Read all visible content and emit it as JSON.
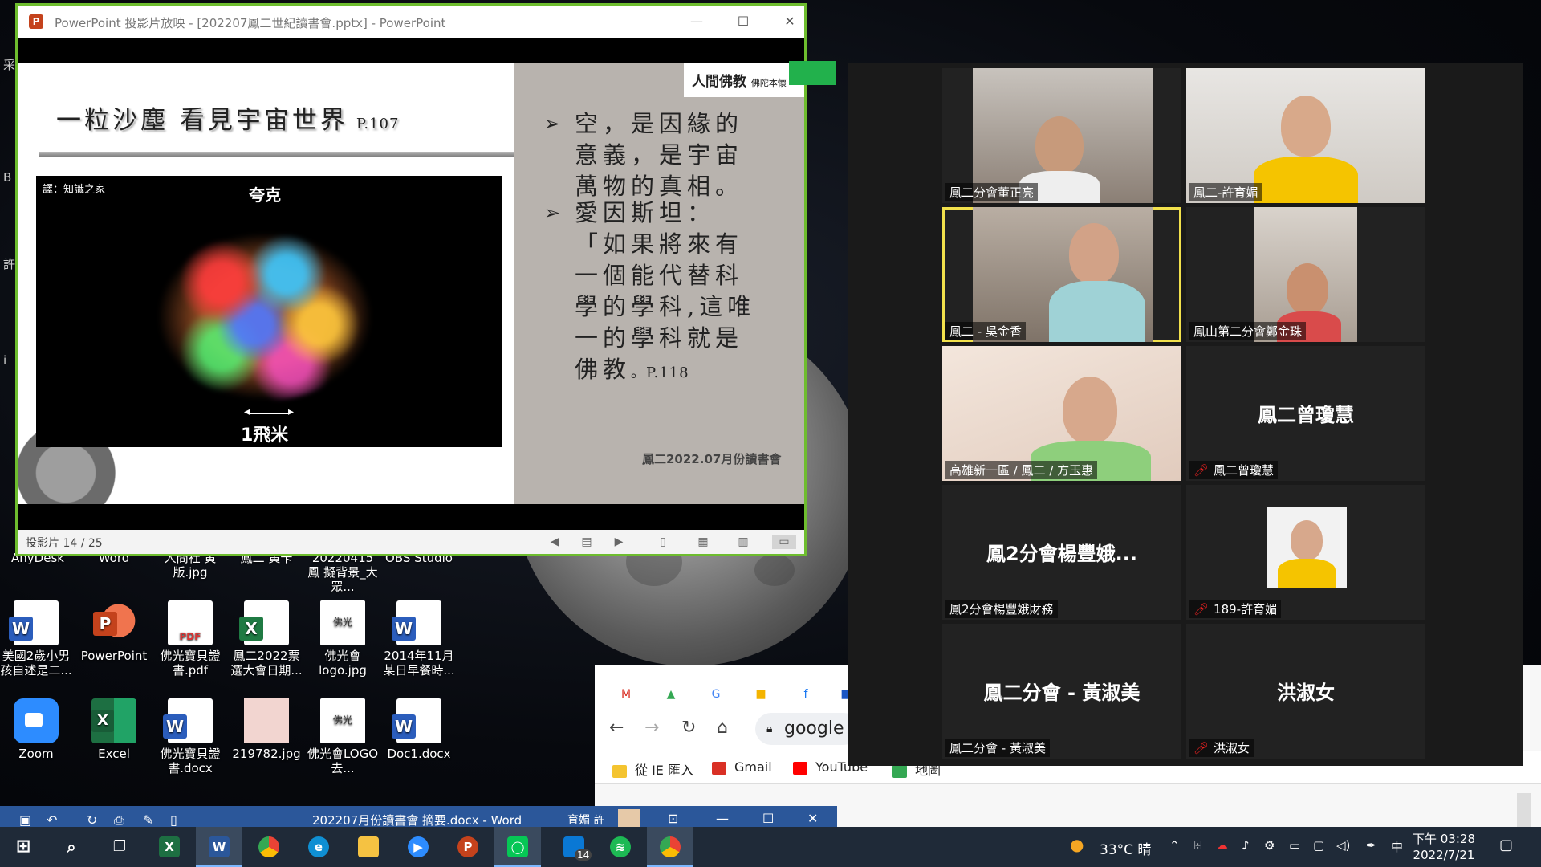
{
  "powerpoint": {
    "window_title": "PowerPoint 投影片放映 - [202207鳳二世紀讀書會.pptx] - PowerPoint",
    "minimize": "—",
    "maximize": "☐",
    "close": "✕",
    "slide_counter": "投影片 14 / 25"
  },
  "slide": {
    "title": "一粒沙塵 看見宇宙世界",
    "title_page": "P.107",
    "image_caption": "譯：知識之家",
    "image_name": "夸克",
    "scale_label": "1飛米",
    "logo_main": "人間佛教",
    "logo_sub": "佛陀本懷",
    "bullet1": "空，是因緣的\n意義，是宇宙\n萬物的真相。",
    "bullet2": "愛因斯坦：\n「如果將來有\n一個能代替科\n學的學科,這唯\n一的學科就是\n佛教",
    "bullet2_page": "。P.118",
    "bullet_marker": "➢",
    "footer": "鳳二2022.07月份讀書會"
  },
  "desktop": {
    "edge_chars": [
      "采",
      "B",
      "許",
      "i"
    ],
    "partial_labels": [
      "AnyDesk",
      "Word",
      "人間社 黃版.jpg",
      "鳳二 黃卡",
      "20220415 鳳 擬背景_大眾...",
      "OBS Studio"
    ],
    "icons_row1": [
      {
        "label": "美國2歲小男孩自述是二...",
        "icon": "word-doc-icon"
      },
      {
        "label": "PowerPoint",
        "icon": "powerpoint-icon"
      },
      {
        "label": "佛光寶貝證書.pdf",
        "icon": "pdf-icon"
      },
      {
        "label": "鳳二2022票選大會日期...",
        "icon": "excel-doc-icon"
      },
      {
        "label": "佛光會logo.jpg",
        "icon": "blia-logo-icon"
      },
      {
        "label": "2014年11月某日早餐時...",
        "icon": "word-doc-icon"
      }
    ],
    "icons_row2": [
      {
        "label": "Zoom",
        "icon": "zoom-icon"
      },
      {
        "label": "Excel",
        "icon": "excel-icon"
      },
      {
        "label": "佛光寶貝證書.docx",
        "icon": "word-doc-icon"
      },
      {
        "label": "219782.jpg",
        "icon": "image-icon"
      },
      {
        "label": "佛光會LOGO 去...",
        "icon": "blia-logo-icon"
      },
      {
        "label": "Doc1.docx",
        "icon": "word-doc-icon"
      }
    ]
  },
  "zoom": {
    "participants": [
      {
        "name": "鳳二分會董正亮",
        "video": true
      },
      {
        "name": "鳳二-許育媚",
        "video": true
      },
      {
        "name": "鳳二 - 吳金香",
        "video": true,
        "active_speaker": true
      },
      {
        "name": "鳳山第二分會鄭金珠",
        "video": true
      },
      {
        "name": "高雄新一區 / 鳳二 / 方玉惠",
        "video": true
      },
      {
        "name": "鳳二曾瓊慧",
        "video": false,
        "display": "鳳二曾瓊慧",
        "muted": true
      },
      {
        "name": "鳳2分會楊豐娥財務",
        "video": false,
        "display": "鳳2分會楊豐娥..."
      },
      {
        "name": "189-許育媚",
        "video": false,
        "display": "",
        "muted": true,
        "has_photo": true
      },
      {
        "name": "鳳二分會 - 黃淑美",
        "video": false,
        "display": "鳳二分會 - 黃淑美"
      },
      {
        "name": "洪淑女",
        "video": false,
        "display": "洪淑女",
        "muted": true
      }
    ]
  },
  "browser": {
    "omnibox_text": "google",
    "bookmarks": [
      {
        "label": "從 IE 匯入",
        "color": "#f4c430"
      },
      {
        "label": "Gmail",
        "color": "#d93025"
      },
      {
        "label": "YouTube",
        "color": "#ff0000"
      },
      {
        "label": "地圖",
        "color": "#34a853"
      }
    ]
  },
  "word": {
    "title": "202207月份讀書會 摘要.docx  -  Word",
    "user": "育媚 許"
  },
  "taskbar": {
    "temperature": "33°C 晴",
    "ime": "中",
    "time": "下午 03:28",
    "date": "2022/7/21",
    "store_badge": "14"
  }
}
